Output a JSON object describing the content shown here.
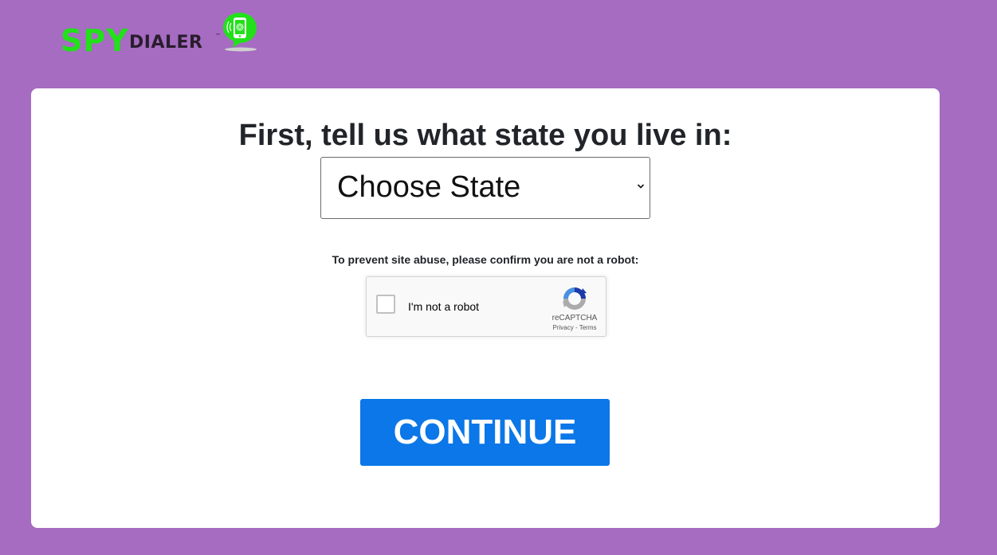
{
  "logo": {
    "brand_primary": "SPY",
    "brand_secondary": "DIALER",
    "trademark": "™",
    "icon": "phone-speech-bubble-icon",
    "colors": {
      "primary": "#22e01a",
      "secondary": "#2a1d2e"
    }
  },
  "form": {
    "heading": "First, tell us what state you live in:",
    "state_select": {
      "selected": "Choose State",
      "icon": "chevron-down-icon"
    },
    "robot_prompt": "To prevent site abuse, please confirm you are not a robot:",
    "recaptcha": {
      "label": "I'm not a robot",
      "brand": "reCAPTCHA",
      "links": "Privacy - Terms",
      "icon": "recaptcha-logo-icon"
    },
    "continue_label": "CONTINUE"
  },
  "colors": {
    "background": "#a56cc1",
    "card": "#ffffff",
    "button": "#0b77e8",
    "heading_text": "#212529"
  }
}
